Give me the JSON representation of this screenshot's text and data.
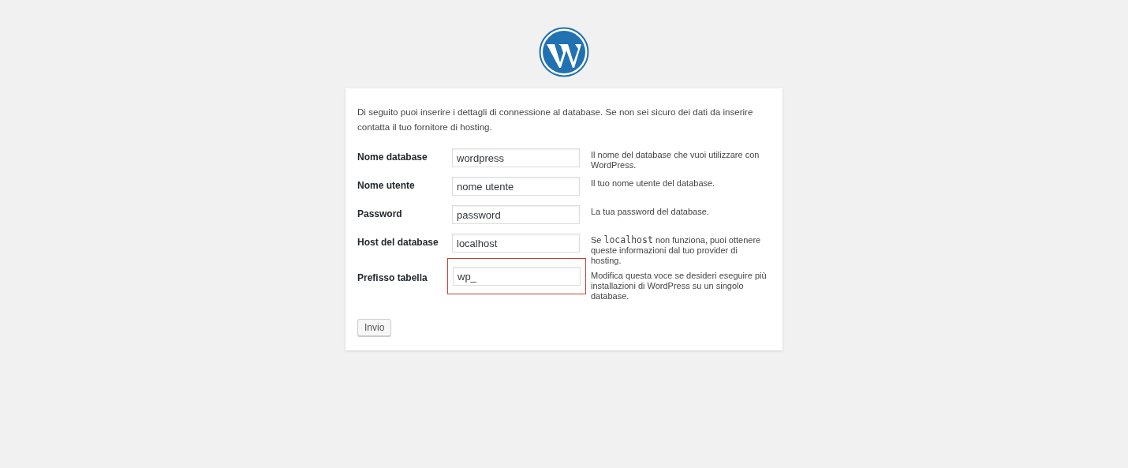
{
  "intro": "Di seguito puoi inserire i dettagli di connessione al database. Se non sei sicuro dei dati da inserire contatta il tuo fornitore di hosting.",
  "fields": [
    {
      "label": "Nome database",
      "value": "wordpress",
      "highlighted": false,
      "help": [
        {
          "kind": "text",
          "text": "Il nome del database che vuoi utilizzare con WordPress."
        }
      ]
    },
    {
      "label": "Nome utente",
      "value": "nome utente",
      "highlighted": false,
      "help": [
        {
          "kind": "text",
          "text": "Il tuo nome utente del database."
        }
      ]
    },
    {
      "label": "Password",
      "value": "password",
      "highlighted": false,
      "help": [
        {
          "kind": "text",
          "text": "La tua password del database."
        }
      ]
    },
    {
      "label": "Host del database",
      "value": "localhost",
      "highlighted": false,
      "help": [
        {
          "kind": "text",
          "text": "Se "
        },
        {
          "kind": "code",
          "text": "localhost"
        },
        {
          "kind": "text",
          "text": " non funziona, puoi ottenere queste informazioni dal tuo provider di hosting."
        }
      ]
    },
    {
      "label": "Prefisso tabella",
      "value": "wp_",
      "highlighted": true,
      "help": [
        {
          "kind": "text",
          "text": "Modifica questa voce se desideri eseguire più installazioni di WordPress su un singolo database."
        }
      ]
    }
  ],
  "submit": "Invio"
}
